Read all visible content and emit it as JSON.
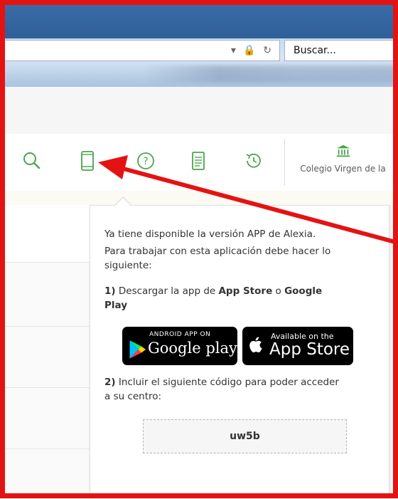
{
  "browser": {
    "search_placeholder": "Buscar..."
  },
  "toolbar": {
    "icons": [
      "search-icon",
      "mobile-icon",
      "help-icon",
      "document-icon",
      "history-icon"
    ],
    "school_name": "Colegio Virgen de la"
  },
  "popover": {
    "intro_line1": "Ya tiene disponible la versión APP de Alexia.",
    "intro_line2": "Para trabajar con esta aplicación debe hacer lo",
    "intro_line3": "siguiente:",
    "step1_num": "1)",
    "step1_pre": " Descargar la app de ",
    "step1_app_store": "App Store",
    "step1_mid": " o ",
    "step1_google": "Google",
    "step1_play": "Play",
    "google_badge_top": "ANDROID APP ON",
    "google_badge_main": "Google play",
    "apple_badge_top": "Available on the",
    "apple_badge_main": "App Store",
    "step2_num": "2)",
    "step2_line1": " Incluir el siguiente código para poder acceder",
    "step2_line2": "a su centro:",
    "code": "uw5b"
  },
  "colors": {
    "accent_green": "#4aa54a",
    "annotation_red": "#e41313"
  }
}
